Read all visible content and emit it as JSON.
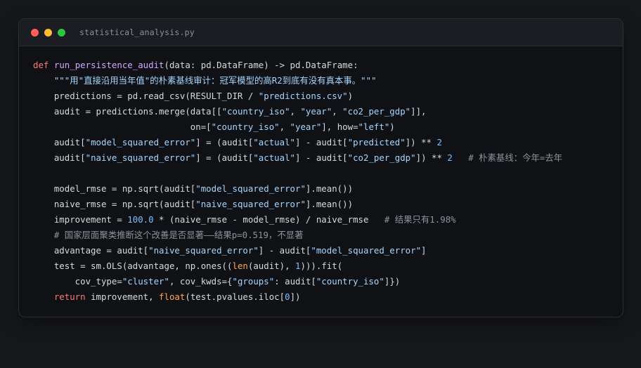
{
  "window": {
    "filename": "statistical_analysis.py",
    "controls": {
      "close_color": "#ff5f57",
      "minimize_color": "#febc2e",
      "maximize_color": "#28c840"
    }
  },
  "theme": {
    "keyword": "#ff7b72",
    "function": "#d2a8ff",
    "string": "#a5d6ff",
    "number": "#79c0ff",
    "comment": "#8b949e",
    "builtin": "#ffa657",
    "text": "#d7dae0"
  },
  "code": {
    "language": "python",
    "lines": [
      [
        [
          "kw",
          "def"
        ],
        [
          "t",
          " "
        ],
        [
          "fn",
          "run_persistence_audit"
        ],
        [
          "t",
          "(data: pd.DataFrame) -> pd.DataFrame:"
        ]
      ],
      [
        [
          "t",
          "    "
        ],
        [
          "str",
          "\"\"\"用\"直接沿用当年值\"的朴素基线审计：冠军模型的高R2到底有没有真本事。\"\"\""
        ]
      ],
      [
        [
          "t",
          "    predictions = pd.read_csv(RESULT_DIR / "
        ],
        [
          "str",
          "\"predictions.csv\""
        ],
        [
          "t",
          ")"
        ]
      ],
      [
        [
          "t",
          "    audit = predictions.merge(data[["
        ],
        [
          "str",
          "\"country_iso\""
        ],
        [
          "t",
          ", "
        ],
        [
          "str",
          "\"year\""
        ],
        [
          "t",
          ", "
        ],
        [
          "str",
          "\"co2_per_gdp\""
        ],
        [
          "t",
          "]],"
        ]
      ],
      [
        [
          "t",
          "                              on=["
        ],
        [
          "str",
          "\"country_iso\""
        ],
        [
          "t",
          ", "
        ],
        [
          "str",
          "\"year\""
        ],
        [
          "t",
          "], how="
        ],
        [
          "str",
          "\"left\""
        ],
        [
          "t",
          ")"
        ]
      ],
      [
        [
          "t",
          "    audit["
        ],
        [
          "str",
          "\"model_squared_error\""
        ],
        [
          "t",
          "] = (audit["
        ],
        [
          "str",
          "\"actual\""
        ],
        [
          "t",
          "] - audit["
        ],
        [
          "str",
          "\"predicted\""
        ],
        [
          "t",
          "]) ** "
        ],
        [
          "num",
          "2"
        ]
      ],
      [
        [
          "t",
          "    audit["
        ],
        [
          "str",
          "\"naive_squared_error\""
        ],
        [
          "t",
          "] = (audit["
        ],
        [
          "str",
          "\"actual\""
        ],
        [
          "t",
          "] - audit["
        ],
        [
          "str",
          "\"co2_per_gdp\""
        ],
        [
          "t",
          "]) ** "
        ],
        [
          "num",
          "2"
        ],
        [
          "t",
          "   "
        ],
        [
          "cm",
          "# 朴素基线：今年=去年"
        ]
      ],
      [
        [
          "t",
          ""
        ]
      ],
      [
        [
          "t",
          "    model_rmse = np.sqrt(audit["
        ],
        [
          "str",
          "\"model_squared_error\""
        ],
        [
          "t",
          "].mean())"
        ]
      ],
      [
        [
          "t",
          "    naive_rmse = np.sqrt(audit["
        ],
        [
          "str",
          "\"naive_squared_error\""
        ],
        [
          "t",
          "].mean())"
        ]
      ],
      [
        [
          "t",
          "    improvement = "
        ],
        [
          "num",
          "100.0"
        ],
        [
          "t",
          " * (naive_rmse - model_rmse) / naive_rmse   "
        ],
        [
          "cm",
          "# 结果只有1.98%"
        ]
      ],
      [
        [
          "t",
          "    "
        ],
        [
          "cm",
          "# 国家层面聚类推断这个改善是否显著——结果p=0.519，不显著"
        ]
      ],
      [
        [
          "t",
          "    advantage = audit["
        ],
        [
          "str",
          "\"naive_squared_error\""
        ],
        [
          "t",
          "] - audit["
        ],
        [
          "str",
          "\"model_squared_error\""
        ],
        [
          "t",
          "]"
        ]
      ],
      [
        [
          "t",
          "    test = sm.OLS(advantage, np.ones(("
        ],
        [
          "bi",
          "len"
        ],
        [
          "t",
          "(audit), "
        ],
        [
          "num",
          "1"
        ],
        [
          "t",
          "))).fit("
        ]
      ],
      [
        [
          "t",
          "        cov_type="
        ],
        [
          "str",
          "\"cluster\""
        ],
        [
          "t",
          ", cov_kwds={"
        ],
        [
          "str",
          "\"groups\""
        ],
        [
          "t",
          ": audit["
        ],
        [
          "str",
          "\"country_iso\""
        ],
        [
          "t",
          "]})"
        ]
      ],
      [
        [
          "t",
          "    "
        ],
        [
          "kw",
          "return"
        ],
        [
          "t",
          " improvement, "
        ],
        [
          "bi",
          "float"
        ],
        [
          "t",
          "(test.pvalues.iloc["
        ],
        [
          "num",
          "0"
        ],
        [
          "t",
          "])"
        ]
      ]
    ]
  }
}
